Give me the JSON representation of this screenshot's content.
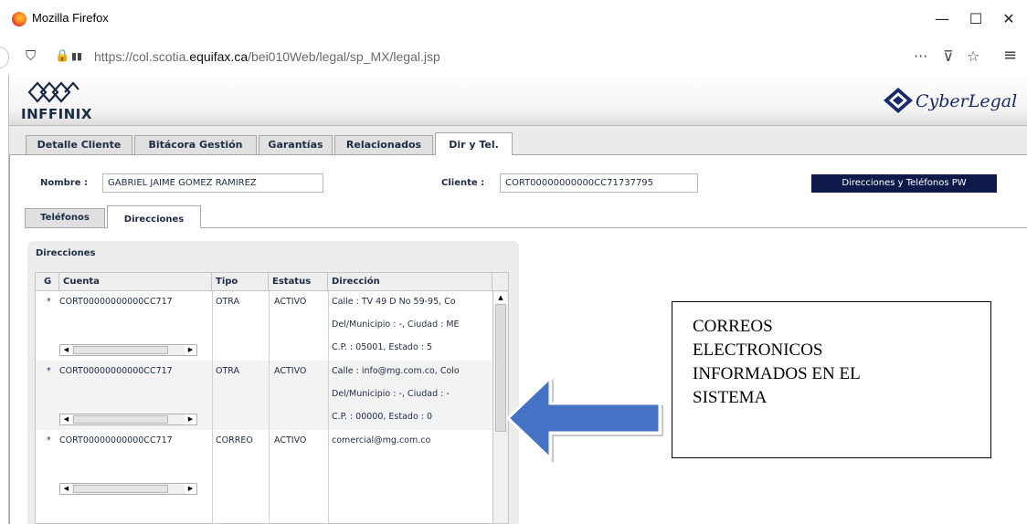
{
  "window": {
    "title": "Mozilla Firefox",
    "minimize_glyph": "—",
    "maximize_glyph": "☐",
    "close_glyph": "✕"
  },
  "browser": {
    "url_prefix": "https://col.scotia.",
    "url_host": "equifax.ca",
    "url_path": "/bei010Web/legal/sp_MX/legal.jsp",
    "icons": [
      "shield-icon",
      "lock-icon",
      "page-actions-icon",
      "pocket-icon",
      "star-icon",
      "menu-icon"
    ],
    "glyphs": {
      "shield": "⛉",
      "lock": "🔒",
      "permissions": "▮▮",
      "more": "···",
      "pocket": "⊽",
      "star": "☆",
      "menu": "≡"
    }
  },
  "header": {
    "left_logo_text": "INFFINIX",
    "right_logo_text": "CyberLegal"
  },
  "tabs": [
    {
      "label": "Detalle Cliente",
      "active": false
    },
    {
      "label": "Bitácora Gestión",
      "active": false
    },
    {
      "label": "Garantías",
      "active": false
    },
    {
      "label": "Relacionados",
      "active": false
    },
    {
      "label": "Dir y Tel.",
      "active": true
    }
  ],
  "client": {
    "nombre_label": "Nombre :",
    "nombre_value": "GABRIEL JAIME GOMEZ RAMIREZ",
    "cliente_label": "Cliente :",
    "cliente_value": "CORT00000000000CC71737795",
    "badge": "Direcciones y Teléfonos PW"
  },
  "subtabs": [
    {
      "label": "Teléfonos",
      "active": false
    },
    {
      "label": "Direcciones",
      "active": true
    }
  ],
  "grid": {
    "title": "Direcciones",
    "columns": [
      "G",
      "Cuenta",
      "Tipo",
      "Estatus",
      "Dirección"
    ],
    "rows": [
      {
        "g": "*",
        "cuenta": "CORT00000000000CC717",
        "tipo": "OTRA",
        "estatus": "ACTIVO",
        "direccion": [
          "Calle : TV 49 D  No 59-95, Co",
          "Del/Municipio : -, Ciudad : ME",
          "C.P. : 05001, Estado : 5"
        ]
      },
      {
        "g": "*",
        "cuenta": "CORT00000000000CC717",
        "tipo": "OTRA",
        "estatus": "ACTIVO",
        "direccion": [
          "Calle : info@mg.com.co, Colo",
          "Del/Municipio : -, Ciudad : -",
          "C.P. : 00000, Estado : 0"
        ]
      },
      {
        "g": "*",
        "cuenta": "CORT00000000000CC717",
        "tipo": "CORREO",
        "estatus": "ACTIVO",
        "direccion": [
          "comercial@mg.com.co",
          "",
          ""
        ]
      }
    ]
  },
  "callout": {
    "lines": [
      "CORREOS",
      "ELECTRONICOS",
      "INFORMADOS EN EL",
      "SISTEMA"
    ]
  },
  "colors": {
    "navy": "#0f1a4b",
    "text": "#1e2b45",
    "arrow": "#4472c4"
  }
}
